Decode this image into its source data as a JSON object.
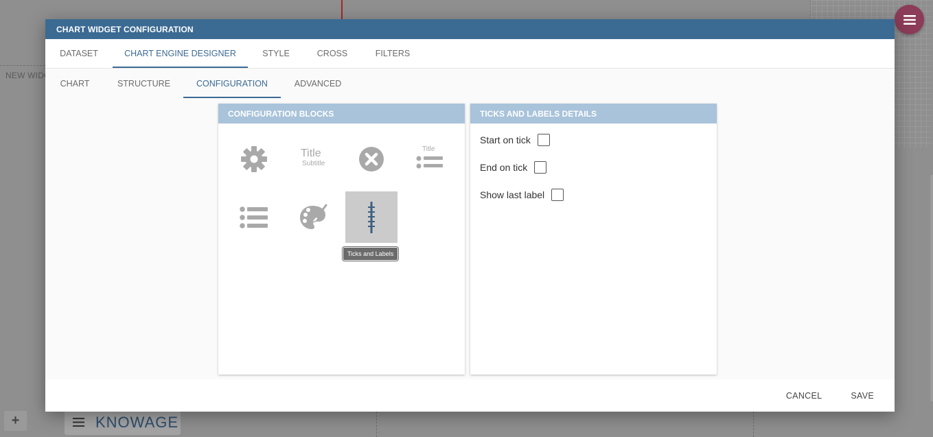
{
  "background": {
    "new_widget_label": "NEW WIDGET",
    "brand": "KNOWAGE"
  },
  "dialog": {
    "title": "CHART WIDGET CONFIGURATION",
    "main_tabs": [
      {
        "label": "DATASET",
        "active": false
      },
      {
        "label": "CHART ENGINE DESIGNER",
        "active": true
      },
      {
        "label": "STYLE",
        "active": false
      },
      {
        "label": "CROSS",
        "active": false
      },
      {
        "label": "FILTERS",
        "active": false
      }
    ],
    "sub_tabs": [
      {
        "label": "CHART",
        "active": false
      },
      {
        "label": "STRUCTURE",
        "active": false
      },
      {
        "label": "CONFIGURATION",
        "active": true
      },
      {
        "label": "ADVANCED",
        "active": false
      }
    ],
    "blocks_panel": {
      "title": "CONFIGURATION BLOCKS",
      "blocks": [
        {
          "icon": "gear-icon"
        },
        {
          "icon": "title-subtitle-icon",
          "title_text": "Title",
          "subtitle_text": "Subtitle"
        },
        {
          "icon": "close-circle-icon"
        },
        {
          "icon": "legend-title-icon",
          "title_text": "Title"
        },
        {
          "icon": "list-icon"
        },
        {
          "icon": "palette-icon"
        },
        {
          "icon": "ticks-labels-icon",
          "selected": true
        }
      ],
      "tooltip": "Ticks and Labels"
    },
    "details_panel": {
      "title": "TICKS AND LABELS DETAILS",
      "options": [
        {
          "label": "Start on tick",
          "checked": false
        },
        {
          "label": "End on tick",
          "checked": false
        },
        {
          "label": "Show last label",
          "checked": false
        }
      ]
    },
    "footer": {
      "cancel_label": "CANCEL",
      "save_label": "SAVE"
    }
  },
  "colors": {
    "header_blue": "#3b6a93",
    "panel_head": "#a8c3da",
    "fab": "#8c3b58",
    "icon_gray": "#a9a9a9"
  }
}
